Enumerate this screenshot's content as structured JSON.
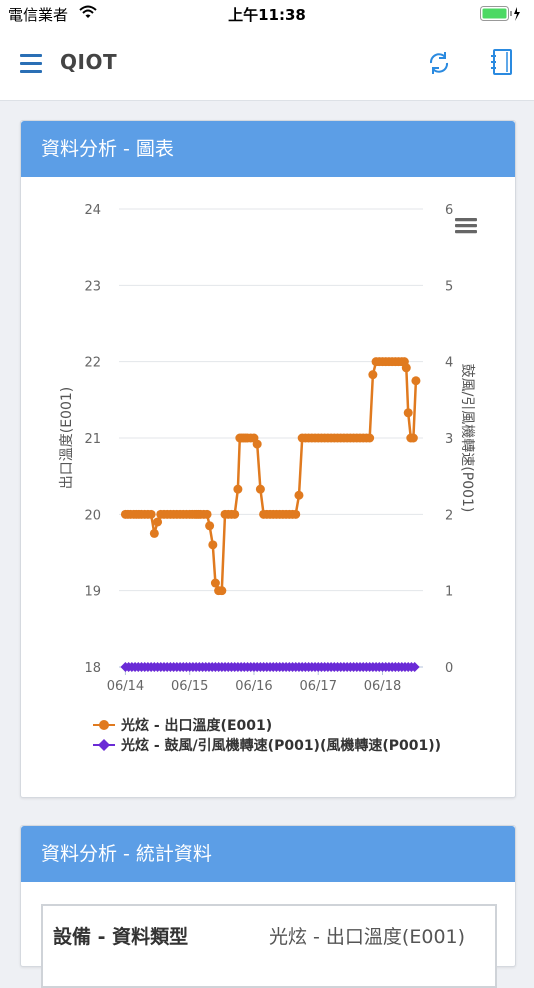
{
  "status_bar": {
    "carrier": "電信業者",
    "time": "上午11:38"
  },
  "header": {
    "title": "QIOT"
  },
  "chart_card": {
    "title": "資料分析 - 圖表"
  },
  "stats_card": {
    "title": "資料分析 - 統計資料",
    "row_key": "設備 - 資料類型",
    "row_value": "光炫 - 出口溫度(E001)"
  },
  "colors": {
    "accent": "#5c9ee6",
    "series1": "#e07a1f",
    "series2": "#6a2bd6",
    "nav_icon": "#2a6fb5"
  },
  "chart_data": {
    "type": "line",
    "ylabel": "出口溫度(E001)",
    "y2label": "鼓風/引風機轉速(P001)",
    "ylim": [
      18,
      24
    ],
    "y2lim": [
      0,
      6
    ],
    "yticks": [
      "18",
      "19",
      "20",
      "21",
      "22",
      "23",
      "24"
    ],
    "y2ticks": [
      "0",
      "1",
      "2",
      "3",
      "4",
      "5",
      "6"
    ],
    "xticks": [
      "06/14",
      "06/15",
      "06/16",
      "06/17",
      "06/18"
    ],
    "xticks_pos": [
      0,
      1,
      2,
      3,
      4
    ],
    "xlim": [
      -0.1,
      4.63
    ],
    "grid": true,
    "legend_position": "bottom-left",
    "series": [
      {
        "name": "光炫 - 出口溫度(E001)",
        "axis": "left",
        "x": [
          0,
          0.04,
          0.08,
          0.13,
          0.17,
          0.21,
          0.25,
          0.3,
          0.35,
          0.4,
          0.45,
          0.5,
          0.55,
          0.6,
          0.65,
          0.7,
          0.75,
          0.8,
          0.85,
          0.9,
          0.95,
          1.0,
          1.04,
          1.08,
          1.11,
          1.14,
          1.17,
          1.22,
          1.27,
          1.31,
          1.36,
          1.4,
          1.45,
          1.5,
          1.55,
          1.6,
          1.65,
          1.7,
          1.75,
          1.78,
          1.81,
          1.84,
          1.87,
          1.9,
          1.95,
          2.0,
          2.05,
          2.1,
          2.15,
          2.2,
          2.25,
          2.3,
          2.35,
          2.4,
          2.45,
          2.5,
          2.55,
          2.6,
          2.65,
          2.7,
          2.75,
          2.8,
          2.85,
          2.9,
          2.95,
          3.0,
          3.05,
          3.1,
          3.15,
          3.2,
          3.25,
          3.3,
          3.35,
          3.4,
          3.45,
          3.5,
          3.55,
          3.6,
          3.65,
          3.7,
          3.75,
          3.8,
          3.85,
          3.9,
          3.95,
          4.0,
          4.05,
          4.1,
          4.15,
          4.2,
          4.25,
          4.3,
          4.34,
          4.37,
          4.4,
          4.44,
          4.48,
          4.52
        ],
        "values": [
          20,
          20,
          20,
          20,
          20,
          20,
          20,
          20,
          20,
          20,
          19.75,
          19.9,
          20,
          20,
          20,
          20,
          20,
          20,
          20,
          20,
          20,
          20,
          20,
          20,
          20,
          20,
          20,
          20,
          20,
          19.85,
          19.6,
          19.1,
          19.0,
          19.0,
          20,
          20,
          20,
          20,
          20.33,
          21,
          21,
          21,
          21,
          21,
          21,
          21,
          20.92,
          20.33,
          20,
          20,
          20,
          20,
          20,
          20,
          20,
          20,
          20,
          20,
          20,
          20.25,
          21,
          21,
          21,
          21,
          21,
          21,
          21,
          21,
          21,
          21,
          21,
          21,
          21,
          21,
          21,
          21,
          21,
          21,
          21,
          21,
          21,
          21,
          21.83,
          22,
          22,
          22,
          22,
          22,
          22,
          22,
          22,
          22,
          22,
          21.92,
          21.33,
          21,
          21,
          21.75
        ]
      },
      {
        "name": "光炫 - 鼓風/引風機轉速(P001)(風機轉速(P001))",
        "axis": "right",
        "x": [
          0,
          0.05,
          0.1,
          0.15,
          0.2,
          0.25,
          0.3,
          0.35,
          0.4,
          0.45,
          0.5,
          0.55,
          0.6,
          0.65,
          0.7,
          0.75,
          0.8,
          0.85,
          0.9,
          0.95,
          1.0,
          1.05,
          1.1,
          1.15,
          1.2,
          1.25,
          1.3,
          1.35,
          1.4,
          1.45,
          1.5,
          1.55,
          1.6,
          1.65,
          1.7,
          1.75,
          1.8,
          1.85,
          1.9,
          1.95,
          2.0,
          2.05,
          2.1,
          2.15,
          2.2,
          2.25,
          2.3,
          2.35,
          2.4,
          2.45,
          2.5,
          2.55,
          2.6,
          2.65,
          2.7,
          2.75,
          2.8,
          2.85,
          2.9,
          2.95,
          3.0,
          3.05,
          3.1,
          3.15,
          3.2,
          3.25,
          3.3,
          3.35,
          3.4,
          3.45,
          3.5,
          3.55,
          3.6,
          3.65,
          3.7,
          3.75,
          3.8,
          3.85,
          3.9,
          3.95,
          4.0,
          4.05,
          4.1,
          4.15,
          4.2,
          4.25,
          4.3,
          4.35,
          4.4,
          4.45,
          4.5
        ],
        "values": [
          0,
          0,
          0,
          0,
          0,
          0,
          0,
          0,
          0,
          0,
          0,
          0,
          0,
          0,
          0,
          0,
          0,
          0,
          0,
          0,
          0,
          0,
          0,
          0,
          0,
          0,
          0,
          0,
          0,
          0,
          0,
          0,
          0,
          0,
          0,
          0,
          0,
          0,
          0,
          0,
          0,
          0,
          0,
          0,
          0,
          0,
          0,
          0,
          0,
          0,
          0,
          0,
          0,
          0,
          0,
          0,
          0,
          0,
          0,
          0,
          0,
          0,
          0,
          0,
          0,
          0,
          0,
          0,
          0,
          0,
          0,
          0,
          0,
          0,
          0,
          0,
          0,
          0,
          0,
          0,
          0,
          0,
          0,
          0,
          0,
          0,
          0,
          0,
          0,
          0,
          0
        ]
      }
    ],
    "legend": [
      "光炫 - 出口溫度(E001)",
      "光炫 - 鼓風/引風機轉速(P001)(風機轉速(P001))"
    ]
  }
}
